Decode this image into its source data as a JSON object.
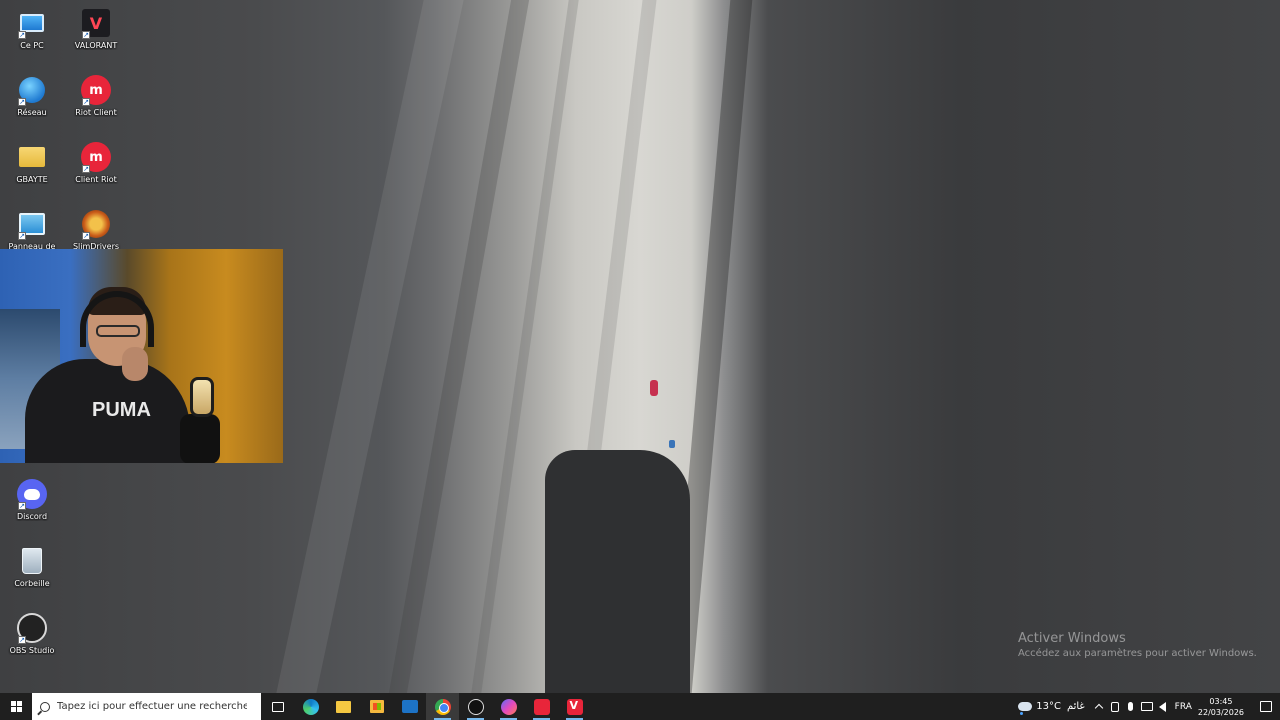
{
  "desktop": {
    "icons": [
      {
        "label": "Ce PC",
        "icon": "computer-icon"
      },
      {
        "label": "VALORANT",
        "icon": "valorant-icon"
      },
      {
        "label": "Réseau",
        "icon": "network-icon"
      },
      {
        "label": "Riot Client",
        "icon": "riot-client-icon"
      },
      {
        "label": "GBAYTE",
        "icon": "folder-icon"
      },
      {
        "label": "Client Riot",
        "icon": "riot-client-icon"
      },
      {
        "label": "Panneau de",
        "icon": "control-panel-icon"
      },
      {
        "label": "SlimDrivers",
        "icon": "slimdrivers-icon"
      },
      {
        "label": "Discord",
        "icon": "discord-icon"
      },
      {
        "label": "Corbeille",
        "icon": "recycle-bin-icon"
      },
      {
        "label": "OBS Studio",
        "icon": "obs-icon"
      }
    ],
    "webcam_logo_text": "PUMA",
    "valorant_glyph": "V",
    "riot_glyph": "m"
  },
  "watermark": {
    "line1": "Activer Windows",
    "line2": "Accédez aux paramètres pour activer Windows."
  },
  "taskbar": {
    "search_placeholder": "Tapez ici pour effectuer une recherche",
    "pinned": [
      "task-view",
      "edge",
      "file-explorer",
      "microsoft-store",
      "mail",
      "chrome",
      "obs-studio",
      "messenger",
      "riot-client",
      "valorant"
    ],
    "active_app": "chrome",
    "weather": {
      "temp": "13°C",
      "condition": "غائم"
    },
    "language": "FRA",
    "time": "03:45",
    "date": "22/03/2026"
  },
  "colors": {
    "taskbar_bg": "#1f1f1f",
    "accent": "#76b9ed",
    "discord": "#5865f2",
    "riot": "#e8253a"
  }
}
